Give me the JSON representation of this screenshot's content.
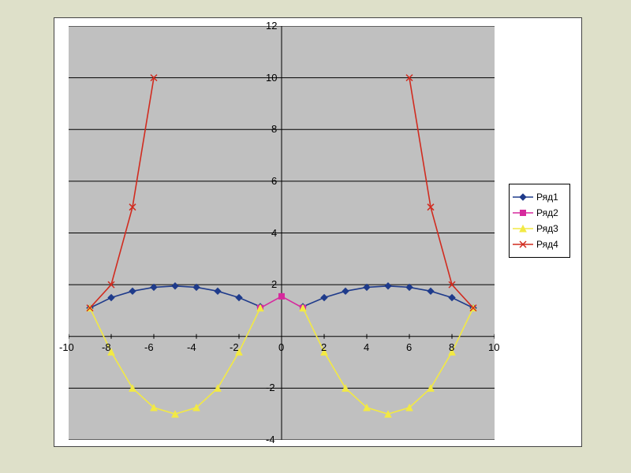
{
  "legend": {
    "items": [
      {
        "label": "Ряд1",
        "color": "#1f3b8b"
      },
      {
        "label": "Ряд2",
        "color": "#d62a9d"
      },
      {
        "label": "Ряд3",
        "color": "#f2e944"
      },
      {
        "label": "Ряд4",
        "color": "#d12b1f"
      }
    ]
  },
  "axes": {
    "x_ticks": [
      -10,
      -8,
      -6,
      -4,
      -2,
      0,
      2,
      4,
      6,
      8,
      10
    ],
    "y_ticks": [
      -4,
      -2,
      0,
      2,
      4,
      6,
      8,
      10,
      12
    ]
  },
  "chart_data": {
    "type": "line",
    "xlabel": "",
    "ylabel": "",
    "title": "",
    "xlim": [
      -10,
      10
    ],
    "ylim": [
      -4,
      12
    ],
    "series": [
      {
        "name": "Ряд1",
        "color": "#1f3b8b",
        "marker": "diamond",
        "x": [
          -9,
          -8,
          -7,
          -6,
          -5,
          -4,
          -3,
          -2,
          -1
        ],
        "y": [
          1.1,
          1.5,
          1.75,
          1.9,
          1.95,
          1.9,
          1.75,
          1.5,
          1.15
        ]
      },
      {
        "name": "Ряд1b",
        "legend_alias": "Ряд1",
        "color": "#1f3b8b",
        "marker": "diamond",
        "x": [
          1,
          2,
          3,
          4,
          5,
          6,
          7,
          8,
          9
        ],
        "y": [
          1.15,
          1.5,
          1.75,
          1.9,
          1.95,
          1.9,
          1.75,
          1.5,
          1.1
        ]
      },
      {
        "name": "Ряд2",
        "color": "#d62a9d",
        "marker": "square",
        "x": [
          -1,
          0,
          1
        ],
        "y": [
          1.1,
          1.55,
          1.1
        ]
      },
      {
        "name": "Ряд3",
        "color": "#f2e944",
        "marker": "triangle",
        "x": [
          -9,
          -8,
          -7,
          -6,
          -5,
          -4,
          -3,
          -2,
          -1
        ],
        "y": [
          1.1,
          -0.6,
          -2.0,
          -2.75,
          -3.0,
          -2.75,
          -2.0,
          -0.6,
          1.1
        ]
      },
      {
        "name": "Ряд3b",
        "legend_alias": "Ряд3",
        "color": "#f2e944",
        "marker": "triangle",
        "x": [
          1,
          2,
          3,
          4,
          5,
          6,
          7,
          8,
          9
        ],
        "y": [
          1.1,
          -0.6,
          -2.0,
          -2.75,
          -3.0,
          -2.75,
          -2.0,
          -0.6,
          1.1
        ]
      },
      {
        "name": "Ряд4",
        "color": "#d12b1f",
        "marker": "xmark",
        "x": [
          -9,
          -8,
          -7,
          -6
        ],
        "y": [
          1.1,
          2.0,
          5.0,
          10.0
        ]
      },
      {
        "name": "Ряд4b",
        "legend_alias": "Ряд4",
        "color": "#d12b1f",
        "marker": "xmark",
        "x": [
          6,
          7,
          8,
          9
        ],
        "y": [
          10.0,
          5.0,
          2.0,
          1.1
        ]
      }
    ]
  }
}
